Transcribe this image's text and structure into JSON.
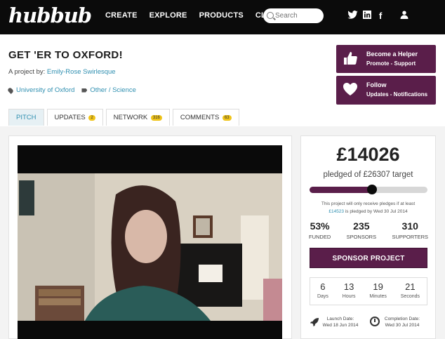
{
  "nav": {
    "logo": "hubbub",
    "links": [
      "CREATE",
      "EXPLORE",
      "PRODUCTS",
      "CLIENTS"
    ],
    "search_placeholder": "Search",
    "social": [
      "twitter-icon",
      "linkedin-icon",
      "facebook-icon",
      "user-icon"
    ],
    "social_glyphs": {
      "twitter": "🐦",
      "linkedin": "in",
      "facebook": "f",
      "user": "👤"
    }
  },
  "project": {
    "title": "GET 'ER TO OXFORD!",
    "byline_prefix": "A project by:",
    "author": "Emily-Rose Swirlesque",
    "location": "University of Oxford",
    "category": "Other / Science"
  },
  "actions": [
    {
      "title": "Become a Helper",
      "subtitle": "Promote - Support",
      "icon": "thumbs-up-icon"
    },
    {
      "title": "Follow",
      "subtitle": "Updates - Notifications",
      "icon": "heart-icon"
    }
  ],
  "tabs": [
    {
      "label": "PITCH",
      "badge": ""
    },
    {
      "label": "UPDATES",
      "badge": "2"
    },
    {
      "label": "NETWORK",
      "badge": "316"
    },
    {
      "label": "COMMENTS",
      "badge": "63"
    }
  ],
  "pledge": {
    "amount": "£14026",
    "target_text": "pledged of £26307 target",
    "progress": 0.53,
    "note_line1": "This project will only receive pledges if at least",
    "note_highlight": "£14523",
    "note_line2": " is pledged by Wed 30 Jul 2014",
    "stats": [
      {
        "value": "53%",
        "label": "FUNDED"
      },
      {
        "value": "235",
        "label": "SPONSORS"
      },
      {
        "value": "310",
        "label": "SUPPORTERS"
      }
    ],
    "sponsor_label": "SPONSOR PROJECT",
    "countdown": [
      {
        "value": "6",
        "label": "Days"
      },
      {
        "value": "13",
        "label": "Hours"
      },
      {
        "value": "19",
        "label": "Minutes"
      },
      {
        "value": "21",
        "label": "Seconds"
      }
    ],
    "launch_label": "Launch Date:",
    "launch_date": "Wed 18 Jun 2014",
    "completion_label": "Completion Date:",
    "completion_date": "Wed 30 Jul 2014"
  },
  "colors": {
    "brand": "#5a1e4a",
    "link": "#2f8fb0",
    "nav": "#0b0b0b",
    "badge": "#f0c419"
  }
}
